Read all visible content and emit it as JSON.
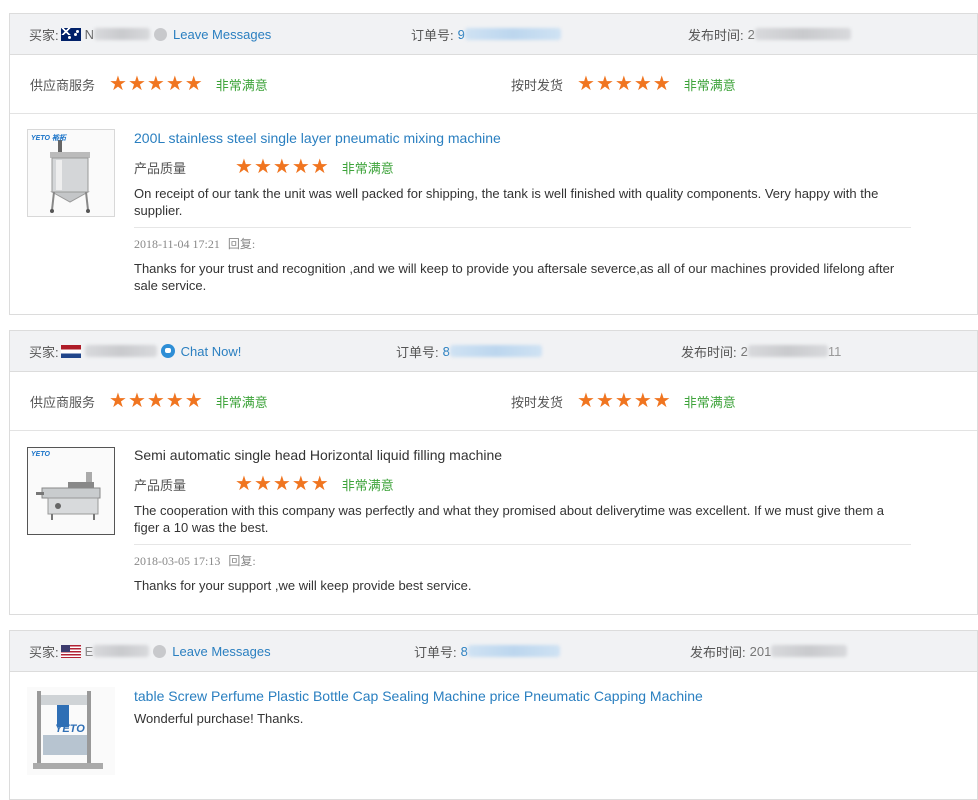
{
  "labels": {
    "buyer": "买家:",
    "order_no": "订单号:",
    "post_time": "发布时间:",
    "supplier_service": "供应商服务",
    "on_time_delivery": "按时发货",
    "product_quality": "产品质量",
    "very_satisfied": "非常满意",
    "reply": "回复:"
  },
  "colors": {
    "star": "#f07520",
    "satisfied": "#3da33a",
    "link": "#2a7fc0",
    "header_bg": "#f1f2f4"
  },
  "reviews": [
    {
      "buyer_flag": "flag-australia",
      "buyer_name_visible": "N",
      "order_no_visible": "9",
      "post_time_visible": "2",
      "action": {
        "label": "Leave Messages",
        "icon": "message-icon"
      },
      "supplier_service_stars": 5,
      "on_time_delivery_stars": 5,
      "product": {
        "title": "200L stainless steel single layer pneumatic mixing machine",
        "thumb_logo": "YETO 裕拓",
        "quality_stars": 5,
        "comment": "On receipt of our tank the unit was well packed for shipping, the tank is well finished with quality components. Very happy with the supplier."
      },
      "reply": {
        "time": "2018-11-04 17:21",
        "text": "Thanks for your trust and recognition ,and we will keep to provide you aftersale severce,as all of our machines provided lifelong after sale service."
      }
    },
    {
      "buyer_flag": "flag-netherlands",
      "buyer_name_visible": "",
      "order_no_visible": "8",
      "post_time_visible": "2",
      "post_time_tail": "11",
      "action": {
        "label": "Chat Now!",
        "icon": "chat-icon"
      },
      "supplier_service_stars": 5,
      "on_time_delivery_stars": 5,
      "product": {
        "title": "Semi automatic single head Horizontal liquid filling machine",
        "thumb_logo": "YETO",
        "quality_stars": 5,
        "comment": "The cooperation with this company was perfectly and what they promised about deliverytime was excellent. If we must give them a figer a 10 was the best."
      },
      "reply": {
        "time": "2018-03-05 17:13",
        "text": "Thanks for your support ,we will keep provide best service."
      }
    },
    {
      "buyer_flag": "flag-united-states",
      "buyer_name_visible": "E",
      "order_no_visible": "8",
      "post_time_visible": "201",
      "action": {
        "label": "Leave Messages",
        "icon": "message-icon"
      },
      "product": {
        "title": "table Screw Perfume Plastic Bottle Cap Sealing Machine price Pneumatic Capping Machine",
        "thumb_logo": "YETO",
        "comment": "Wonderful purchase! Thanks."
      }
    }
  ]
}
